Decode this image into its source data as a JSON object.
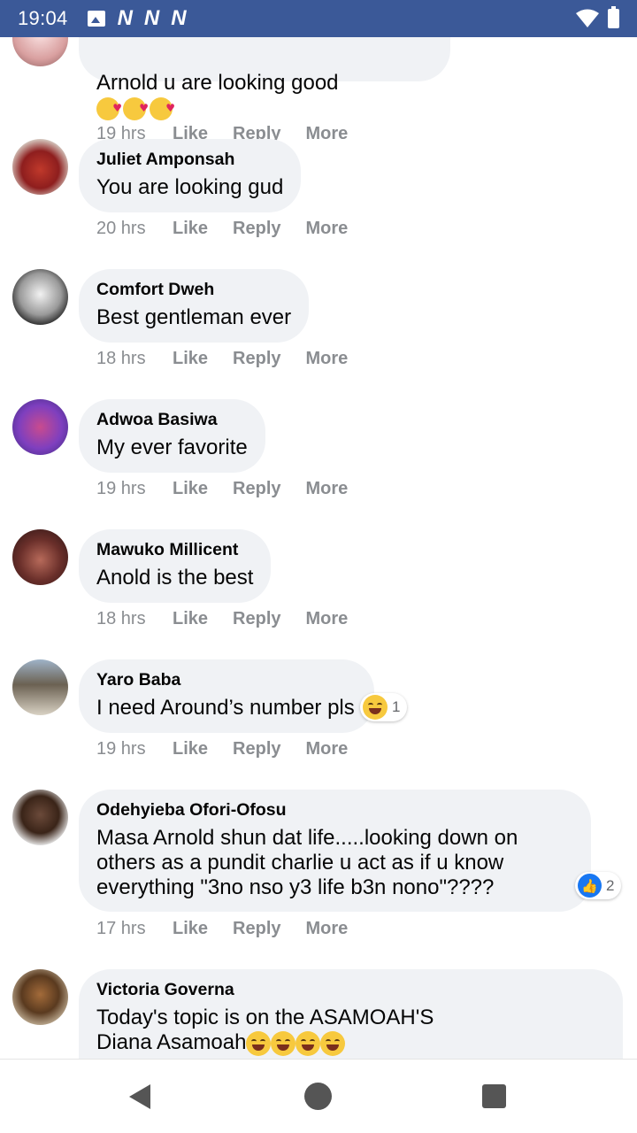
{
  "status_bar": {
    "time": "19:04",
    "notification_letters": [
      "N",
      "N",
      "N"
    ],
    "icons": [
      "image-icon",
      "wifi-icon",
      "battery-icon"
    ]
  },
  "actions": {
    "like": "Like",
    "reply": "Reply",
    "more": "More"
  },
  "comments": [
    {
      "author": "",
      "text": "Arnold u are looking good",
      "time": "19 hrs"
    },
    {
      "author": "Juliet Amponsah",
      "text": "You are looking gud",
      "time": "20 hrs"
    },
    {
      "author": "Comfort Dweh",
      "text": "Best gentleman ever",
      "time": "18 hrs"
    },
    {
      "author": "Adwoa Basiwa",
      "text": "My ever favorite",
      "time": "19 hrs"
    },
    {
      "author": "Mawuko Millicent",
      "text": "Anold is the best",
      "time": "18 hrs"
    },
    {
      "author": "Yaro Baba",
      "text": "I need Around’s number pls",
      "time": "19 hrs",
      "reaction": {
        "icon": "laughing-emoji-icon",
        "count": "1"
      }
    },
    {
      "author": "Odehyieba Ofori-Ofosu",
      "text": "Masa Arnold shun dat life.....looking down on\nothers as a pundit charlie u act as if u know\neverything \"3no nso y3 life b3n nono\"????",
      "time": "17 hrs",
      "reaction": {
        "icon": "like-reaction-icon",
        "count": "2"
      }
    },
    {
      "author": "Victoria Governa",
      "text": "Today's topic is on the ASAMOAH'S\nDiana Asamoah",
      "time": ""
    }
  ],
  "colors": {
    "status_bar": "#3b5998",
    "bubble": "#f0f2f5",
    "meta_text": "#8a8d91",
    "like_blue": "#1877f2"
  }
}
